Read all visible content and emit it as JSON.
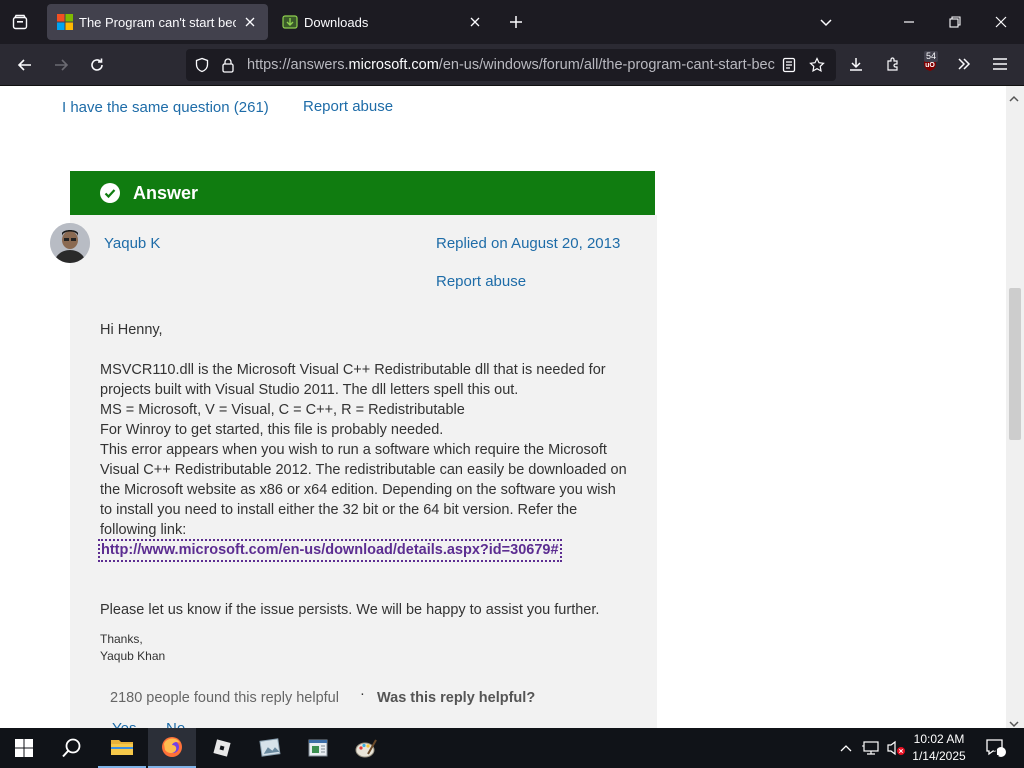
{
  "browser": {
    "tabs": [
      {
        "title": "The Program can't start because",
        "active": true
      },
      {
        "title": "Downloads",
        "active": false
      }
    ],
    "url": {
      "prefix": "https://answers.",
      "domain": "microsoft.com",
      "path": "/en-us/windows/forum/all/the-program-cant-start-bec"
    },
    "extension_badge": "54"
  },
  "page": {
    "same_question": "I have the same question (261)",
    "report_abuse_top": "Report abuse",
    "answer_heading": "Answer",
    "author": "Yaqub K",
    "replied": "Replied on August 20, 2013",
    "report_abuse": "Report abuse",
    "greeting": "Hi Henny,",
    "paragraph": "MSVCR110.dll is the Microsoft Visual C++ Redistributable dll that is needed for projects built with Visual Studio 2011. The dll letters spell this out.",
    "line2": "MS = Microsoft, V = Visual, C = C++, R = Redistributable",
    "line3": "For Winroy to get started, this file is probably needed.",
    "paragraph2": "This error appears when you wish to run a software which require the Microsoft Visual C++ Redistributable 2012. The redistributable can easily be downloaded on the Microsoft website as x86 or x64 edition. Depending on the software you wish to install you need to install either the 32 bit or the 64 bit version. Refer the following link:",
    "link": "http://www.microsoft.com/en-us/download/details.aspx?id=30679#",
    "closing": "Please let us know if the issue persists. We will be happy to assist you further.",
    "thanks": "Thanks,",
    "signature": "Yaqub Khan",
    "helpful_count": "2180 people found this reply helpful",
    "separator": "·",
    "was_helpful": "Was this reply helpful?",
    "yes": "Yes",
    "no": "No"
  },
  "taskbar": {
    "time": "10:02 AM",
    "date": "1/14/2025",
    "notification_count": "1"
  }
}
